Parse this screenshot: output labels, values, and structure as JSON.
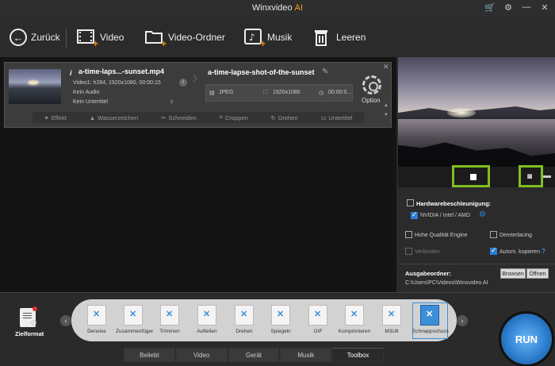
{
  "window": {
    "title": "Winxvideo",
    "title_ai": "AI",
    "icons": [
      "cart-icon",
      "settings-icon",
      "minimize-icon",
      "close-icon"
    ]
  },
  "toolbar": {
    "back": "Zurück",
    "video": "Video",
    "video_folder": "Video-Ordner",
    "music": "Musik",
    "clear": "Leeren"
  },
  "task": {
    "source_name": "a-time-laps...-sunset.mp4",
    "video_info": "Video1: h264, 1920x1080, 00:00:15",
    "audio": "Kein Audio",
    "subtitle": "Kein Untertitel",
    "output_name": "a-time-lapse-shot-of-the-sunset",
    "format": "JPEG",
    "resolution": "1920x1080",
    "duration": "00:00:0...",
    "option": "Option",
    "edit": [
      "Effekt",
      "Wasserzeichen",
      "Schneiden",
      "Croppen",
      "Drehen",
      "Untertitel"
    ]
  },
  "settings": {
    "hw_title": "Hardwarebeschleunigung:",
    "hw_option": "NVIDIA / Intel / AMD",
    "quality": "Hohe Qualität Engine",
    "deinterlacing": "Deinterlacing",
    "merge": "Verbinden",
    "autocopy": "Autom. kopieren",
    "help": "?",
    "output_folder_title": "Ausgabeordner:",
    "output_path": "C:\\Users\\PC\\Videos\\Winxvideo AI",
    "browse": "Browsen",
    "open": "Öffnen"
  },
  "bottom": {
    "target_format": "Zielformat",
    "tools": [
      "Denoise",
      "Zusammenfüger",
      "Trimmen",
      "Aufteilen",
      "Drehen",
      "Spiegeln",
      "GIF",
      "Komprimieren",
      "M3U8",
      "Schnappschuss"
    ],
    "tabs": [
      "Beliebt",
      "Video",
      "Gerät",
      "Musik",
      "Toolbox"
    ],
    "run": "RUN"
  },
  "colors": {
    "accent_orange": "#f08a20",
    "highlight_green": "#7fbf1f",
    "accent_blue": "#2a7fd4"
  }
}
